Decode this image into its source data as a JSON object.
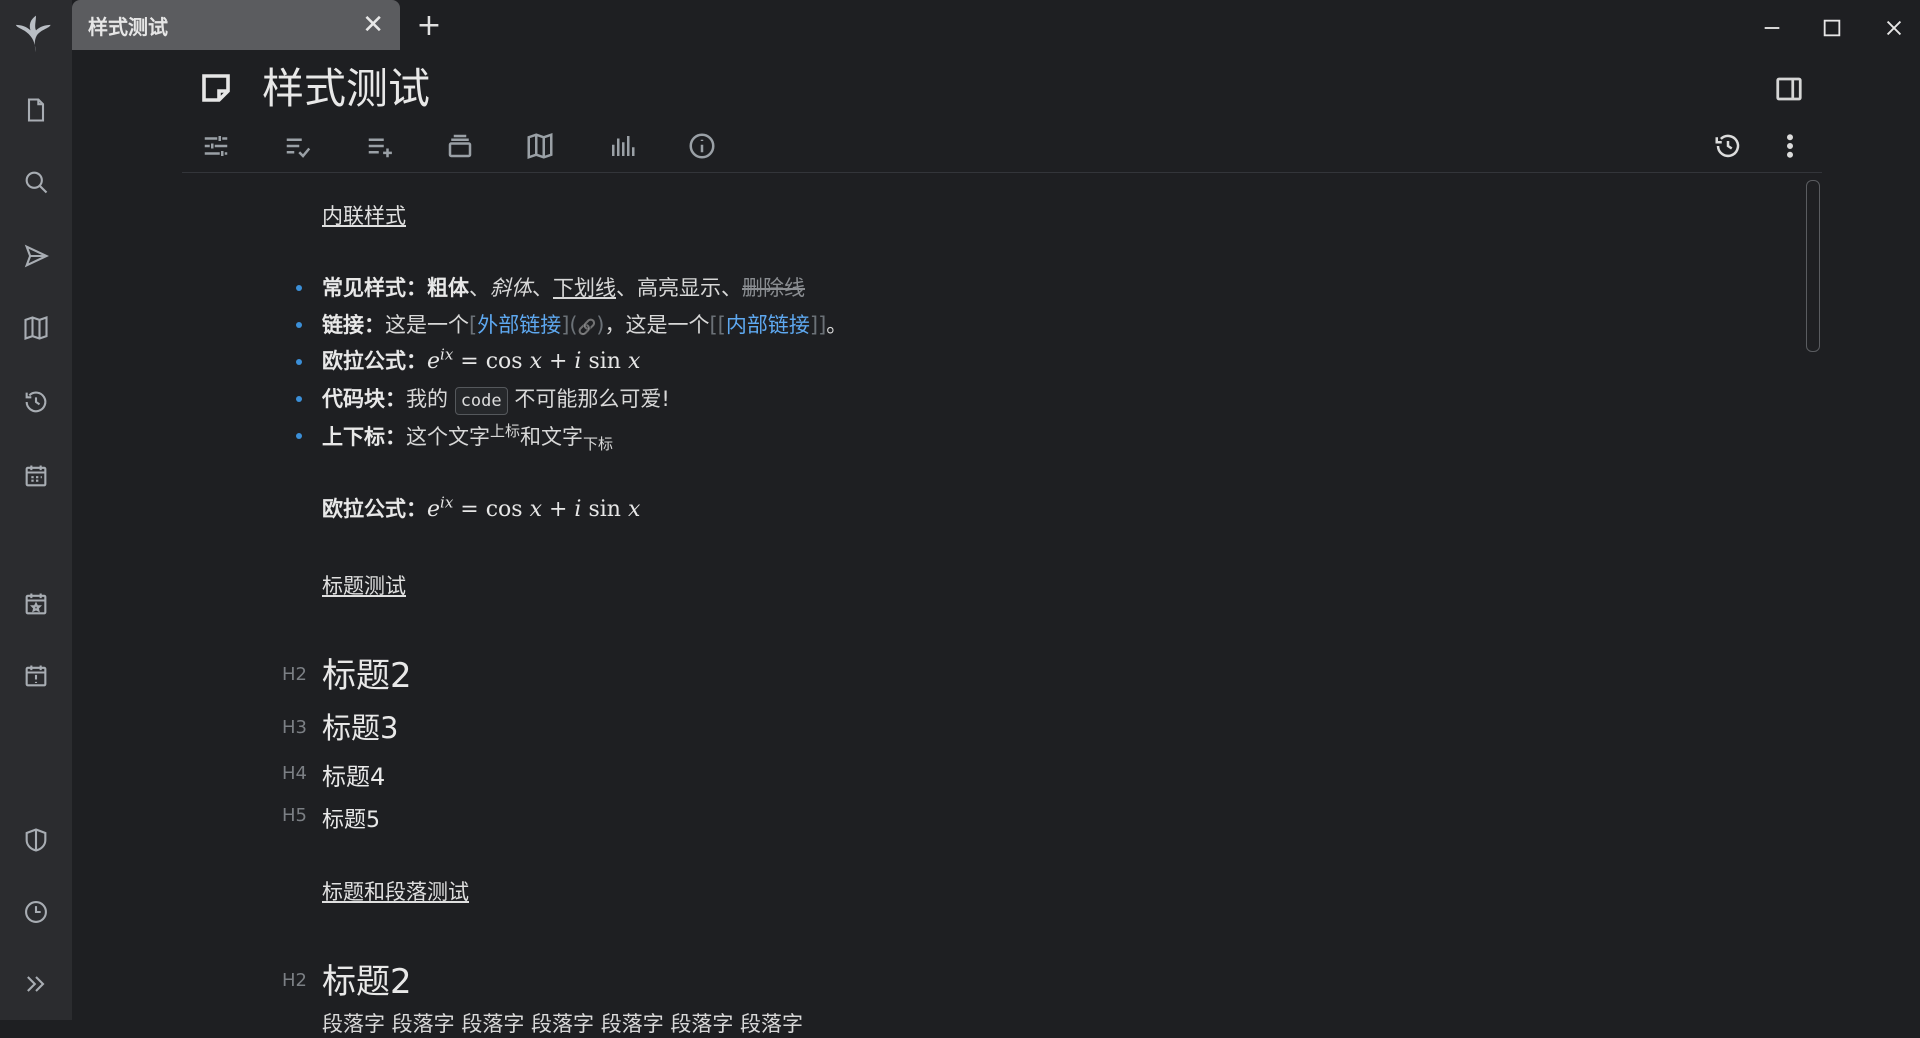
{
  "tab": {
    "title": "样式测试",
    "close": "✕",
    "new": "+"
  },
  "window": {
    "minimize": "minimize",
    "maximize": "maximize",
    "close": "close"
  },
  "doc": {
    "title": "样式测试"
  },
  "content": {
    "inline_heading": "内联样式",
    "common": {
      "label": "常见样式：",
      "bold": "粗体",
      "sep1": "、",
      "italic": "斜体",
      "sep2": "、",
      "underline": "下划线",
      "mid": "、高亮显示、",
      "strike": "删除线"
    },
    "links": {
      "label": "链接：",
      "pre": "这是一个",
      "open_br": "[",
      "ext": "外部链接",
      "close_br": "](",
      "link_icon": "🔗",
      "paren_close": ")",
      "mid": "，这是一个",
      "open_wiki": "[[",
      "internal": "内部链接",
      "close_wiki": "]]",
      "end": "。"
    },
    "euler": {
      "label": "欧拉公式："
    },
    "code": {
      "label": "代码块：",
      "pre": "我的",
      "code": "code",
      "post": "不可能那么可爱!"
    },
    "supsub": {
      "label": "上下标：",
      "pre": "这个文字",
      "sup": "上标",
      "mid": "和文字",
      "sub": "下标"
    },
    "euler_block": {
      "label": "欧拉公式："
    },
    "heading_test": "标题测试",
    "headings": [
      {
        "level": "H2",
        "text": "标题2"
      },
      {
        "level": "H3",
        "text": "标题3"
      },
      {
        "level": "H4",
        "text": "标题4"
      },
      {
        "level": "H5",
        "text": "标题5"
      }
    ],
    "heading_para_test": "标题和段落测试",
    "h2b": {
      "level": "H2",
      "text": "标题2"
    },
    "para": "段落字  段落字  段落字  段落字  段落字  段落字  段落字"
  }
}
